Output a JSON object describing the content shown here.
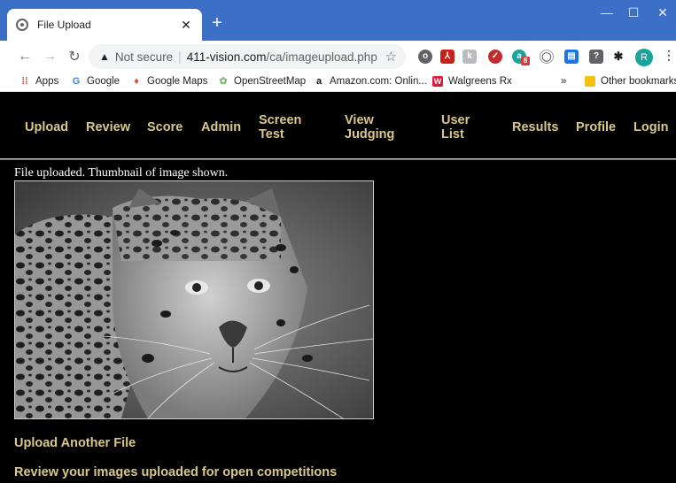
{
  "browser": {
    "tab_title": "File Upload",
    "new_tab_icon": "plus-icon",
    "address": {
      "security_label": "Not secure",
      "host": "411-vision.com",
      "path": "/ca/imageupload.php"
    },
    "bookmarks": [
      {
        "label": "Apps",
        "icon": "apps-grid-icon"
      },
      {
        "label": "Google",
        "icon": "google-icon"
      },
      {
        "label": "Google Maps",
        "icon": "maps-pin-icon"
      },
      {
        "label": "OpenStreetMap",
        "icon": "osm-icon"
      },
      {
        "label": "Amazon.com: Onlin...",
        "icon": "amazon-icon"
      },
      {
        "label": "Walgreens Rx",
        "icon": "walgreens-icon"
      }
    ],
    "overflow_label": "»",
    "other_bookmarks": "Other bookmarks",
    "avatar_initial": "R",
    "extension_badge": "8"
  },
  "nav": {
    "upload": "Upload",
    "review": "Review",
    "score": "Score",
    "admin": "Admin",
    "screen_test_1": "Screen",
    "screen_test_2": "Test",
    "view_judging_1": "View",
    "view_judging_2": "Judging",
    "user_list_1": "User",
    "user_list_2": "List",
    "results": "Results",
    "profile": "Profile",
    "login": "Login"
  },
  "content": {
    "status_message": "File uploaded. Thumbnail of image shown.",
    "upload_another": "Upload Another File",
    "review_link": "Review your images uploaded for open competitions"
  },
  "colors": {
    "titlebar": "#3b70c6",
    "page_bg": "#000000",
    "link_gold": "#d9c88a"
  }
}
